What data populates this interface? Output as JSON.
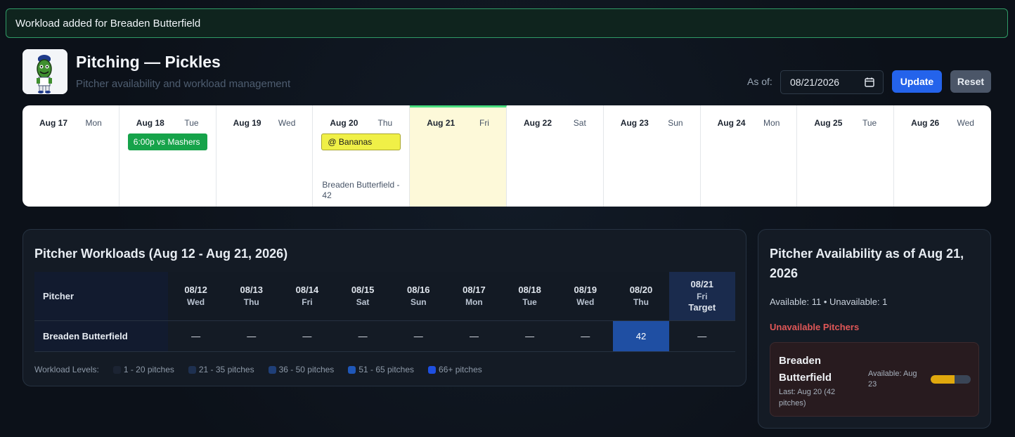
{
  "toast": {
    "message": "Workload added for Breaden Butterfield"
  },
  "header": {
    "title": "Pitching — Pickles",
    "subtitle": "Pitcher availability and workload management",
    "as_of_label": "As of:",
    "as_of_value": "08/21/2026",
    "update_label": "Update",
    "reset_label": "Reset"
  },
  "calendar": {
    "days": [
      {
        "date": "Aug 17",
        "dow": "Mon"
      },
      {
        "date": "Aug 18",
        "dow": "Tue",
        "event": "6:00p vs Mashers"
      },
      {
        "date": "Aug 19",
        "dow": "Wed"
      },
      {
        "date": "Aug 20",
        "dow": "Thu",
        "event": "@ Bananas",
        "note": "Breaden Butterfield - 42"
      },
      {
        "date": "Aug 21",
        "dow": "Fri"
      },
      {
        "date": "Aug 22",
        "dow": "Sat"
      },
      {
        "date": "Aug 23",
        "dow": "Sun"
      },
      {
        "date": "Aug 24",
        "dow": "Mon"
      },
      {
        "date": "Aug 25",
        "dow": "Tue"
      },
      {
        "date": "Aug 26",
        "dow": "Wed"
      }
    ]
  },
  "workloads": {
    "title": "Pitcher Workloads (Aug 12 - Aug 21, 2026)",
    "pitcher_header": "Pitcher",
    "columns": [
      {
        "date": "08/12",
        "dow": "Wed"
      },
      {
        "date": "08/13",
        "dow": "Thu"
      },
      {
        "date": "08/14",
        "dow": "Fri"
      },
      {
        "date": "08/15",
        "dow": "Sat"
      },
      {
        "date": "08/16",
        "dow": "Sun"
      },
      {
        "date": "08/17",
        "dow": "Mon"
      },
      {
        "date": "08/18",
        "dow": "Tue"
      },
      {
        "date": "08/19",
        "dow": "Wed"
      },
      {
        "date": "08/20",
        "dow": "Thu"
      },
      {
        "date": "08/21",
        "dow": "Fri",
        "target": "Target"
      }
    ],
    "rows": [
      {
        "name": "Breaden Butterfield",
        "cells": [
          "—",
          "—",
          "—",
          "—",
          "—",
          "—",
          "—",
          "—",
          "42",
          "—"
        ]
      }
    ],
    "legend_label": "Workload Levels:",
    "legend": [
      {
        "label": "1 - 20 pitches",
        "color": "#1c2433"
      },
      {
        "label": "21 - 35 pitches",
        "color": "#1e3050"
      },
      {
        "label": "36 - 50 pitches",
        "color": "#1f3f78"
      },
      {
        "label": "51 - 65 pitches",
        "color": "#1f57b8"
      },
      {
        "label": "66+ pitches",
        "color": "#1e4fe0"
      }
    ]
  },
  "availability": {
    "title": "Pitcher Availability as of Aug 21, 2026",
    "summary": "Available: 11 • Unavailable: 1",
    "unavailable_heading": "Unavailable Pitchers",
    "pitchers": [
      {
        "name": "Breaden Butterfield",
        "last": "Last: Aug 20 (42 pitches)",
        "available": "Available: Aug 23",
        "recovery_fraction": 0.6
      }
    ]
  }
}
